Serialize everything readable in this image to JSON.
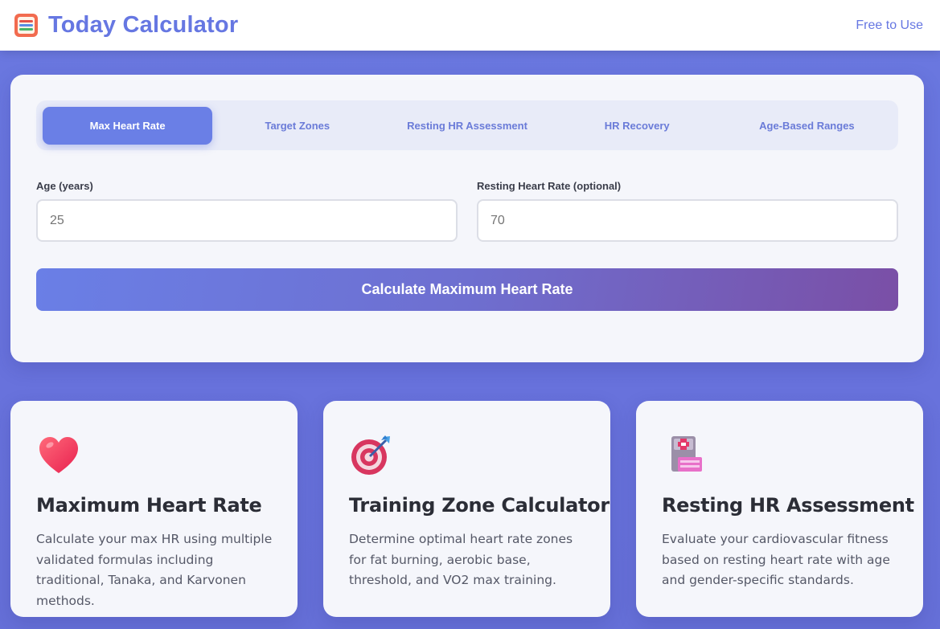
{
  "header": {
    "title": "Today Calculator",
    "free_link": "Free to Use"
  },
  "tabs": [
    {
      "label": "Max Heart Rate",
      "active": true
    },
    {
      "label": "Target Zones",
      "active": false
    },
    {
      "label": "Resting HR Assessment",
      "active": false
    },
    {
      "label": "HR Recovery",
      "active": false
    },
    {
      "label": "Age-Based Ranges",
      "active": false
    }
  ],
  "form": {
    "age_label": "Age (years)",
    "age_placeholder": "25",
    "resting_label": "Resting Heart Rate (optional)",
    "resting_placeholder": "70",
    "submit_label": "Calculate Maximum Heart Rate"
  },
  "features": [
    {
      "icon": "heart-icon",
      "title": "Maximum Heart Rate",
      "description": "Calculate your max HR using multiple validated formulas including traditional, Tanaka, and Karvonen methods."
    },
    {
      "icon": "target-icon",
      "title": "Training Zone Calculator",
      "description": "Determine optimal heart rate zones for fat burning, aerobic base, threshold, and VO2 max training."
    },
    {
      "icon": "medical-clipboard-icon",
      "title": "Resting HR Assessment",
      "description": "Evaluate your cardiovascular fitness based on resting heart rate with age and gender-specific standards."
    }
  ],
  "colors": {
    "accent": "#6677e2",
    "background": "#6872dc",
    "card": "#f5f6fb"
  }
}
